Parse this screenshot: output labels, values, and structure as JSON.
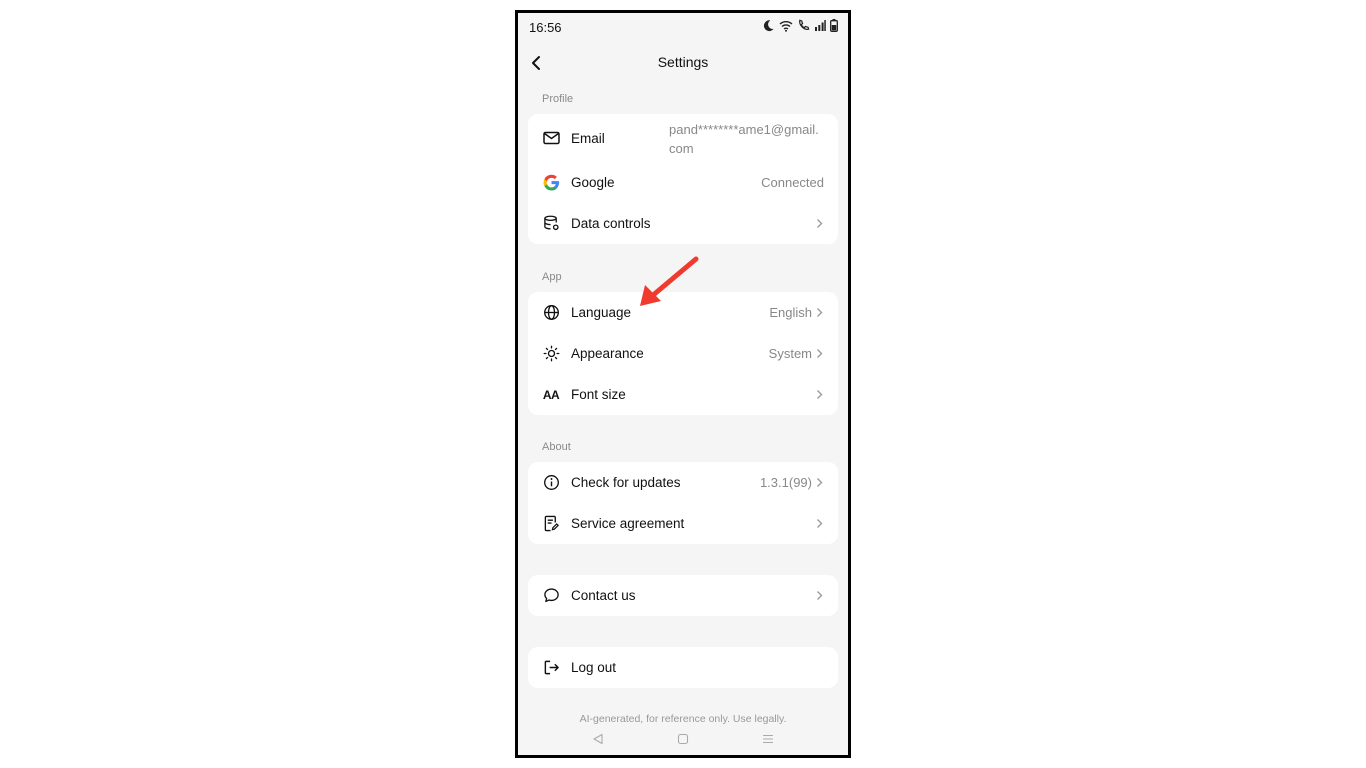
{
  "status_bar": {
    "time": "16:56"
  },
  "header": {
    "title": "Settings"
  },
  "sections": {
    "profile": {
      "label": "Profile",
      "email": {
        "label": "Email",
        "value": "pand********ame1@gmail.com"
      },
      "google": {
        "label": "Google",
        "value": "Connected"
      },
      "data_controls": {
        "label": "Data controls"
      }
    },
    "app": {
      "label": "App",
      "language": {
        "label": "Language",
        "value": "English"
      },
      "appearance": {
        "label": "Appearance",
        "value": "System"
      },
      "font_size": {
        "label": "Font size",
        "icon_text": "AA"
      }
    },
    "about": {
      "label": "About",
      "check_updates": {
        "label": "Check for updates",
        "value": "1.3.1(99)"
      },
      "service_agreement": {
        "label": "Service agreement"
      }
    },
    "contact": {
      "label": "Contact us"
    },
    "logout": {
      "label": "Log out"
    }
  },
  "footer": {
    "note": "AI-generated, for reference only. Use legally."
  },
  "colors": {
    "background": "#f5f5f5",
    "card": "#ffffff",
    "annotation_arrow": "#f03a2e"
  }
}
